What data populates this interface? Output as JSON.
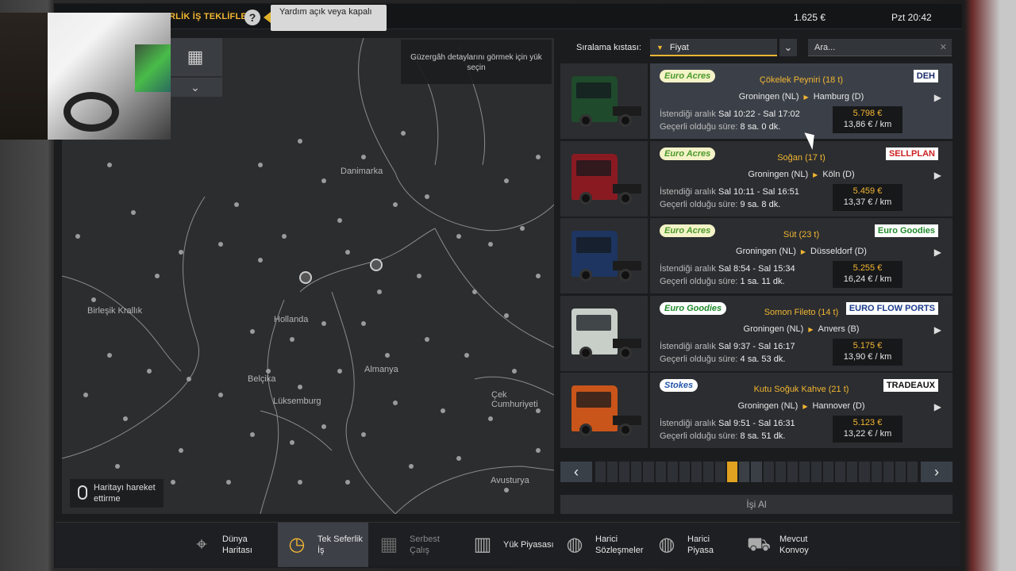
{
  "top_bar": {
    "title": "RLİK İŞ TEKLİFLERİ",
    "help_icon": "question-icon",
    "tooltip": "Yardım açık veya kapalı",
    "money": "1.625 €",
    "clock": "Pzt 20:42"
  },
  "map": {
    "route_hint": "Güzergâh detaylarını görmek için yük seçin",
    "labels": [
      "Danimarka",
      "Birleşik Krallık",
      "Hollanda",
      "Almanya",
      "Belçika",
      "Lüksemburg",
      "Çek Cumhuriyeti",
      "Avusturya"
    ],
    "move_hint": "Haritayı hareket ettirme"
  },
  "sort": {
    "label": "Sıralama kıstası:",
    "selected": "Fiyat",
    "search_placeholder": "Ara..."
  },
  "jobs": [
    {
      "cargo": "Çökelek Peyniri (18 t)",
      "from": "Groningen (NL)",
      "to": "Hamburg (D)",
      "window_label": "İstendiği aralık",
      "window": "Sal 10:22 - Sal 17:02",
      "valid_label": "Geçerli olduğu süre:",
      "valid": "8 sa. 0 dk.",
      "price": "5.798 €",
      "per_km": "13,86 € / km",
      "logo_left": "Euro Acres",
      "logo_right": "DEH",
      "cab_color": "#1f4a2c"
    },
    {
      "cargo": "Soğan (17 t)",
      "from": "Groningen (NL)",
      "to": "Köln (D)",
      "window_label": "İstendiği aralık",
      "window": "Sal 10:11 - Sal 16:51",
      "valid_label": "Geçerli olduğu süre:",
      "valid": "9 sa. 8 dk.",
      "price": "5.459 €",
      "per_km": "13,37 € / km",
      "logo_left": "Euro Acres",
      "logo_right": "SELLPLAN",
      "cab_color": "#8a1a22"
    },
    {
      "cargo": "Süt (23 t)",
      "from": "Groningen (NL)",
      "to": "Düsseldorf (D)",
      "window_label": "İstendiği aralık",
      "window": "Sal 8:54 - Sal 15:34",
      "valid_label": "Geçerli olduğu süre:",
      "valid": "1 sa. 11 dk.",
      "price": "5.255 €",
      "per_km": "16,24 € / km",
      "logo_left": "Euro Acres",
      "logo_right": "Euro Goodies",
      "cab_color": "#1d3560"
    },
    {
      "cargo": "Somon Fileto (14 t)",
      "from": "Groningen (NL)",
      "to": "Anvers (B)",
      "window_label": "İstendiği aralık",
      "window": "Sal 9:37 - Sal 16:17",
      "valid_label": "Geçerli olduğu süre:",
      "valid": "4 sa. 53 dk.",
      "price": "5.175 €",
      "per_km": "13,90 € / km",
      "logo_left": "Euro Goodies",
      "logo_right": "EURO FLOW PORTS",
      "cab_color": "#c8cfc8"
    },
    {
      "cargo": "Kutu Soğuk Kahve (21 t)",
      "from": "Groningen (NL)",
      "to": "Hannover (D)",
      "window_label": "İstendiği aralık",
      "window": "Sal 9:51 - Sal 16:31",
      "valid_label": "Geçerli olduğu süre:",
      "valid": "8 sa. 51 dk.",
      "price": "5.123 €",
      "per_km": "13,22 € / km",
      "logo_left": "Stokes",
      "logo_right": "TRADEAUX",
      "cab_color": "#c9551a"
    }
  ],
  "accept_button": "İşi Al",
  "bottom_nav": [
    {
      "label1": "Dünya",
      "label2": "Haritası",
      "icon": "world-map-icon"
    },
    {
      "label1": "Tek Seferlik",
      "label2": "İş",
      "icon": "clock-box-icon"
    },
    {
      "label1": "Serbest",
      "label2": "Çalış",
      "icon": "freight-icon"
    },
    {
      "label1": "Yük Piyasası",
      "label2": "",
      "icon": "cargo-market-icon"
    },
    {
      "label1": "Harici",
      "label2": "Sözleşmeler",
      "icon": "globe-contracts-icon"
    },
    {
      "label1": "Harici",
      "label2": "Piyasa",
      "icon": "globe-market-icon"
    },
    {
      "label1": "Mevcut",
      "label2": "Konvoy",
      "icon": "convoy-icon"
    }
  ],
  "colors": {
    "accent": "#f2b632",
    "panel": "#2b2d30",
    "selected": "#3b4048"
  }
}
